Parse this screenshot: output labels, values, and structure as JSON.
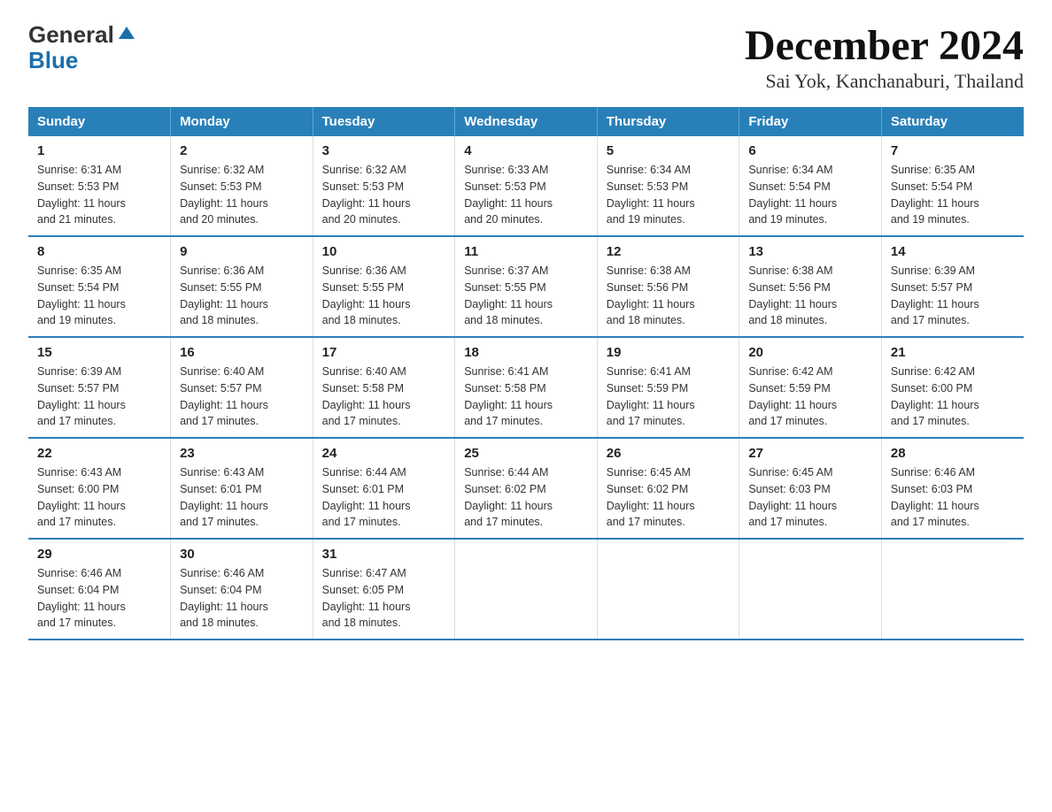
{
  "header": {
    "title": "December 2024",
    "subtitle": "Sai Yok, Kanchanaburi, Thailand",
    "logo_general": "General",
    "logo_blue": "Blue"
  },
  "weekdays": [
    "Sunday",
    "Monday",
    "Tuesday",
    "Wednesday",
    "Thursday",
    "Friday",
    "Saturday"
  ],
  "weeks": [
    [
      {
        "day": "1",
        "sunrise": "6:31 AM",
        "sunset": "5:53 PM",
        "daylight": "11 hours and 21 minutes."
      },
      {
        "day": "2",
        "sunrise": "6:32 AM",
        "sunset": "5:53 PM",
        "daylight": "11 hours and 20 minutes."
      },
      {
        "day": "3",
        "sunrise": "6:32 AM",
        "sunset": "5:53 PM",
        "daylight": "11 hours and 20 minutes."
      },
      {
        "day": "4",
        "sunrise": "6:33 AM",
        "sunset": "5:53 PM",
        "daylight": "11 hours and 20 minutes."
      },
      {
        "day": "5",
        "sunrise": "6:34 AM",
        "sunset": "5:53 PM",
        "daylight": "11 hours and 19 minutes."
      },
      {
        "day": "6",
        "sunrise": "6:34 AM",
        "sunset": "5:54 PM",
        "daylight": "11 hours and 19 minutes."
      },
      {
        "day": "7",
        "sunrise": "6:35 AM",
        "sunset": "5:54 PM",
        "daylight": "11 hours and 19 minutes."
      }
    ],
    [
      {
        "day": "8",
        "sunrise": "6:35 AM",
        "sunset": "5:54 PM",
        "daylight": "11 hours and 19 minutes."
      },
      {
        "day": "9",
        "sunrise": "6:36 AM",
        "sunset": "5:55 PM",
        "daylight": "11 hours and 18 minutes."
      },
      {
        "day": "10",
        "sunrise": "6:36 AM",
        "sunset": "5:55 PM",
        "daylight": "11 hours and 18 minutes."
      },
      {
        "day": "11",
        "sunrise": "6:37 AM",
        "sunset": "5:55 PM",
        "daylight": "11 hours and 18 minutes."
      },
      {
        "day": "12",
        "sunrise": "6:38 AM",
        "sunset": "5:56 PM",
        "daylight": "11 hours and 18 minutes."
      },
      {
        "day": "13",
        "sunrise": "6:38 AM",
        "sunset": "5:56 PM",
        "daylight": "11 hours and 18 minutes."
      },
      {
        "day": "14",
        "sunrise": "6:39 AM",
        "sunset": "5:57 PM",
        "daylight": "11 hours and 17 minutes."
      }
    ],
    [
      {
        "day": "15",
        "sunrise": "6:39 AM",
        "sunset": "5:57 PM",
        "daylight": "11 hours and 17 minutes."
      },
      {
        "day": "16",
        "sunrise": "6:40 AM",
        "sunset": "5:57 PM",
        "daylight": "11 hours and 17 minutes."
      },
      {
        "day": "17",
        "sunrise": "6:40 AM",
        "sunset": "5:58 PM",
        "daylight": "11 hours and 17 minutes."
      },
      {
        "day": "18",
        "sunrise": "6:41 AM",
        "sunset": "5:58 PM",
        "daylight": "11 hours and 17 minutes."
      },
      {
        "day": "19",
        "sunrise": "6:41 AM",
        "sunset": "5:59 PM",
        "daylight": "11 hours and 17 minutes."
      },
      {
        "day": "20",
        "sunrise": "6:42 AM",
        "sunset": "5:59 PM",
        "daylight": "11 hours and 17 minutes."
      },
      {
        "day": "21",
        "sunrise": "6:42 AM",
        "sunset": "6:00 PM",
        "daylight": "11 hours and 17 minutes."
      }
    ],
    [
      {
        "day": "22",
        "sunrise": "6:43 AM",
        "sunset": "6:00 PM",
        "daylight": "11 hours and 17 minutes."
      },
      {
        "day": "23",
        "sunrise": "6:43 AM",
        "sunset": "6:01 PM",
        "daylight": "11 hours and 17 minutes."
      },
      {
        "day": "24",
        "sunrise": "6:44 AM",
        "sunset": "6:01 PM",
        "daylight": "11 hours and 17 minutes."
      },
      {
        "day": "25",
        "sunrise": "6:44 AM",
        "sunset": "6:02 PM",
        "daylight": "11 hours and 17 minutes."
      },
      {
        "day": "26",
        "sunrise": "6:45 AM",
        "sunset": "6:02 PM",
        "daylight": "11 hours and 17 minutes."
      },
      {
        "day": "27",
        "sunrise": "6:45 AM",
        "sunset": "6:03 PM",
        "daylight": "11 hours and 17 minutes."
      },
      {
        "day": "28",
        "sunrise": "6:46 AM",
        "sunset": "6:03 PM",
        "daylight": "11 hours and 17 minutes."
      }
    ],
    [
      {
        "day": "29",
        "sunrise": "6:46 AM",
        "sunset": "6:04 PM",
        "daylight": "11 hours and 17 minutes."
      },
      {
        "day": "30",
        "sunrise": "6:46 AM",
        "sunset": "6:04 PM",
        "daylight": "11 hours and 18 minutes."
      },
      {
        "day": "31",
        "sunrise": "6:47 AM",
        "sunset": "6:05 PM",
        "daylight": "11 hours and 18 minutes."
      },
      null,
      null,
      null,
      null
    ]
  ],
  "labels": {
    "sunrise": "Sunrise:",
    "sunset": "Sunset:",
    "daylight": "Daylight:"
  }
}
